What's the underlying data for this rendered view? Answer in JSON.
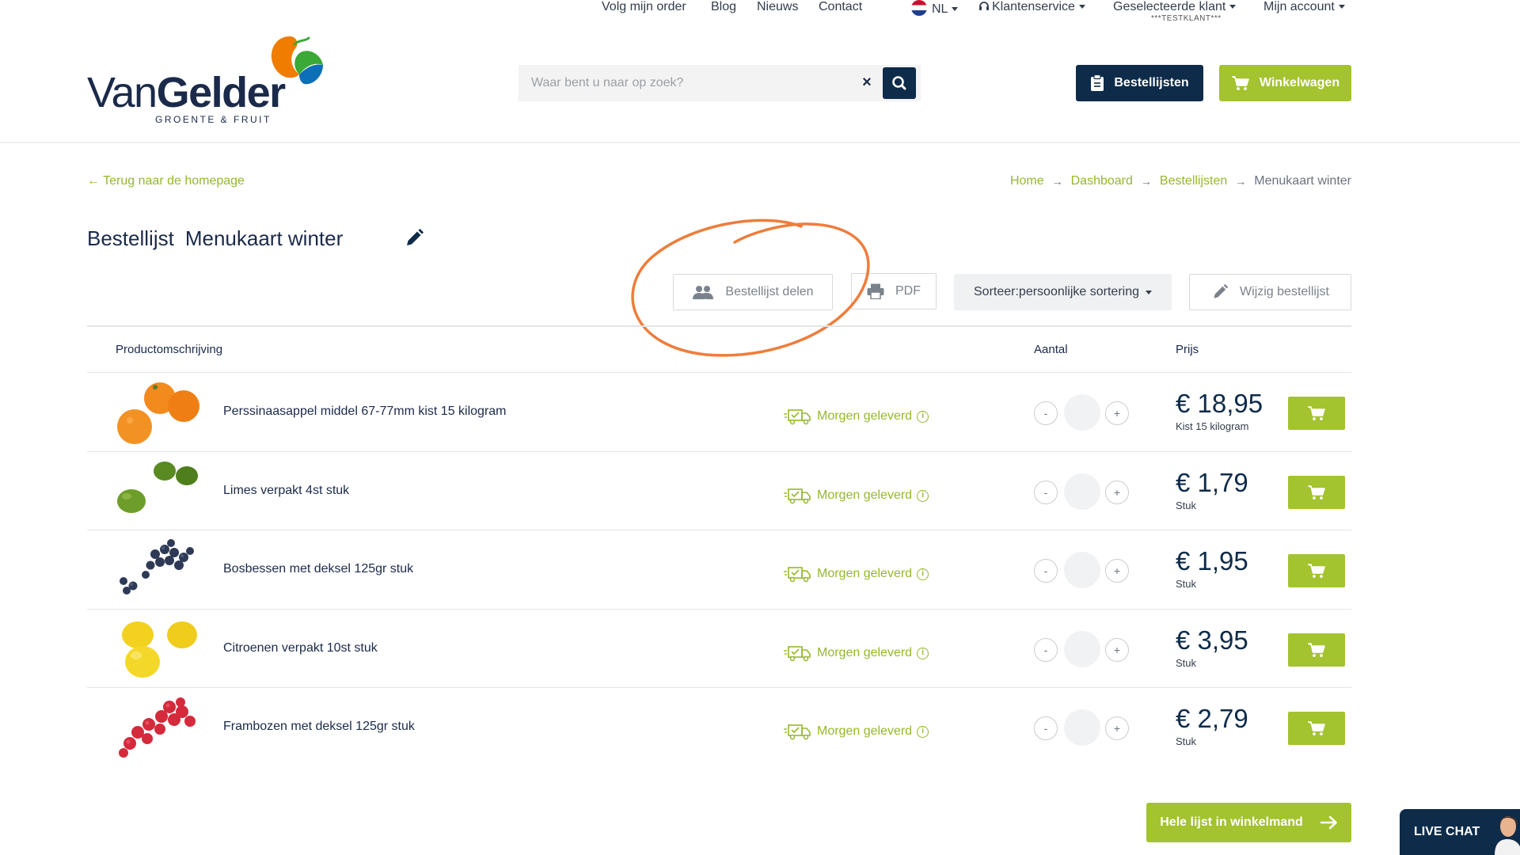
{
  "topnav": {
    "links": [
      "Volg mijn order",
      "Blog",
      "Nieuws",
      "Contact"
    ],
    "language": "NL",
    "customer_service": "Klantenservice",
    "selected_customer": "Geselecteerde klant",
    "selected_customer_sub": "***TESTKLANT***",
    "my_account": "Mijn account"
  },
  "logo": {
    "brand_light": "Van",
    "brand_bold": "Gelder",
    "tagline": "GROENTE & FRUIT",
    "colors": [
      "#f07d00",
      "#3aa935",
      "#0d6fb8"
    ]
  },
  "search": {
    "placeholder": "Waar bent u naar op zoek?",
    "value": "",
    "clear_label": "×"
  },
  "header_buttons": {
    "order_lists": "Bestellijsten",
    "cart": "Winkelwagen"
  },
  "back_link": "Terug naar de homepage",
  "breadcrumb": [
    "Home",
    "Dashboard",
    "Bestellijsten",
    "Menukaart winter"
  ],
  "page": {
    "title_prefix": "Bestellijst",
    "title_name": "Menukaart winter"
  },
  "actions": {
    "share": "Bestellijst delen",
    "pdf": "PDF",
    "sort": "Sorteer:persoonlijke sortering",
    "edit": "Wijzig bestellijst"
  },
  "table": {
    "headers": {
      "description": "Productomschrijving",
      "quantity": "Aantal",
      "price": "Prijs"
    },
    "rows": [
      {
        "name": "Perssinaasappel middel 67-77mm kist 15 kilogram",
        "delivery": "Morgen geleverd",
        "price": "€ 18,95",
        "unit": "Kist 15 kilogram",
        "image": "orange-fruit"
      },
      {
        "name": "Limes verpakt 4st stuk",
        "delivery": "Morgen geleverd",
        "price": "€ 1,79",
        "unit": "Stuk",
        "image": "lime-fruit"
      },
      {
        "name": "Bosbessen met deksel 125gr stuk",
        "delivery": "Morgen geleverd",
        "price": "€ 1,95",
        "unit": "Stuk",
        "image": "blueberry-fruit"
      },
      {
        "name": "Citroenen verpakt 10st stuk",
        "delivery": "Morgen geleverd",
        "price": "€ 3,95",
        "unit": "Stuk",
        "image": "lemon-fruit"
      },
      {
        "name": "Frambozen met deksel 125gr stuk",
        "delivery": "Morgen geleverd",
        "price": "€ 2,79",
        "unit": "Stuk",
        "image": "raspberry-fruit"
      }
    ],
    "minus_label": "-",
    "plus_label": "+"
  },
  "add_all_button": "Hele lijst in winkelmand",
  "live_chat": "LIVE CHAT",
  "colors": {
    "primary_navy": "#0e2b4a",
    "accent_green": "#a3c32f",
    "link_green": "#95b82a",
    "annotation_orange": "#ee7d3b"
  }
}
